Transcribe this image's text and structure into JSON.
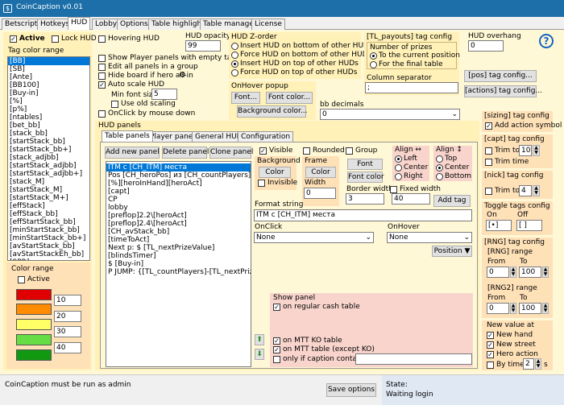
{
  "window": {
    "title": "CoinCaption v0.01"
  },
  "tabs": [
    "Betscript",
    "Hotkeys",
    "HUD",
    "Lobby",
    "Options",
    "Table highlight",
    "Table manager",
    "License"
  ],
  "hud": {
    "active": "Active",
    "lock_hud": "Lock HUD",
    "hovering_hud": "Hovering HUD",
    "tag_color_range": "Tag color range",
    "tags": [
      "[BB]",
      "[SB]",
      "[Ante]",
      "[BB100]",
      "[Buy-in]",
      "[%]",
      "[p%]",
      "[ntables]",
      "[bet_bb]",
      "[stack_bb]",
      "[startStack_bb]",
      "[startStack_bb+]",
      "[stack_adjbb]",
      "[startStack_adjbb]",
      "[startStack_adjbb+]",
      "[stack_M]",
      "[startStack_M]",
      "[startStack_M+]",
      "[effStack]",
      "[effStack_bb]",
      "[effStartStack_bb]",
      "[minStartStack_bb]",
      "[minStartStack_bb+]",
      "[avStartStack_bb]",
      "[avStartStackEh_bb]",
      "[SPR]"
    ],
    "color_range": {
      "label": "Color range",
      "active": "Active",
      "colors": [
        "#e00000",
        "#ff8c00",
        "#ffff66",
        "#66dd44",
        "#119911"
      ],
      "values": [
        "10",
        "20",
        "30",
        "40"
      ]
    },
    "options": {
      "show_player_panels": "Show Player panels with empty tags",
      "edit_all_panels": "Edit all panels in a group",
      "hide_board": "Hide board if hero all-in",
      "auto_scale": "Auto scale HUD",
      "min_font_size": "Min font size",
      "min_font_value": "5",
      "use_old_scaling": "Use old scaling",
      "onclick_mouse_down": "OnClick by mouse down"
    },
    "opacity": {
      "label": "HUD opacity",
      "value": "99"
    },
    "zorder": {
      "label": "HUD Z-order",
      "items": [
        "Insert HUD on bottom of other HUDs",
        "Force HUD on bottom of other HUDs",
        "Insert HUD on top of other HUDs",
        "Force HUD on top of other HUDs"
      ],
      "selected": 2
    },
    "onhover_popup": {
      "label": "OnHover popup",
      "font": "Font...",
      "font_color": "Font color...",
      "bg_color": "Background color..."
    },
    "bb_decimals": {
      "label": "bb decimals",
      "value": "0"
    },
    "tl_payouts": {
      "label": "[TL_payouts] tag config",
      "prizes_label": "Number of prizes",
      "to_current": "To the current position",
      "for_final": "For the final table",
      "col_sep": "Column separator",
      "col_sep_value": ";"
    },
    "overhang": {
      "label": "HUD overhang",
      "value": "0"
    },
    "pos_config": "[pos] tag config...",
    "actions_config": "[actions] tag config...",
    "panels": {
      "label": "HUD panels",
      "subtabs": [
        "Table panels",
        "Player panels",
        "General HUD",
        "Configuration"
      ],
      "add": "Add new panel",
      "delete": "Delete panel",
      "clone": "Clone panel",
      "items": [
        "ITM с [CH_ITM] места",
        "Pos [CH_heroPos] из [CH_countPlayers]",
        "[%][heroInHand][heroAct]",
        "[capt]",
        "CP",
        "lobby",
        "[preflop]2.2\\[heroAct]",
        "[preflop]2.4\\[heroAct]",
        "[CH_avStack_bb]",
        "[timeToAct]",
        "Next p: $ [TL_nextPrizeValue]",
        "[blindsTimer]",
        "$ [Buy-in]",
        "P JUMP: {[TL_countPlayers]-[TL_nextPrize]}"
      ],
      "visible": "Visible",
      "rounded": "Rounded",
      "group": "Group",
      "background": "Background",
      "color": "Color",
      "invisible": "Invisible",
      "frame": "Frame",
      "frame_color": "Color",
      "width": "Width",
      "width_value": "0",
      "font": "Font",
      "font_color": "Font color",
      "border_width": "Border width",
      "border_value": "3",
      "fixed_width": "Fixed width",
      "fixed_value": "40",
      "align_h": "Align ↔",
      "left": "Left",
      "center": "Center",
      "right": "Right",
      "align_v": "Align ↕",
      "top": "Top",
      "vcenter": "Center",
      "bottom": "Bottom",
      "add_tag": "Add tag",
      "format_string": "Format string",
      "format_value": "ITM с [CH_ITM] места",
      "onclick": "OnClick",
      "onclick_value": "None",
      "onhover": "OnHover",
      "onhover_value": "None",
      "position": "Position ▼",
      "show_panel": "Show panel",
      "on_regular": "on regular cash table",
      "on_mtt_ko": "on MTT KO table",
      "on_mtt_ex": "on MTT table (except KO)",
      "only_caption": "only if caption contains"
    },
    "sizing": {
      "label": "[sizing] tag config",
      "add_action": "Add action symbol"
    },
    "capt": {
      "label": "[capt] tag config",
      "trim_to": "Trim to",
      "trim_value": "10",
      "trim_time": "Trim time"
    },
    "nick": {
      "label": "[nick] tag config",
      "trim_to": "Trim to",
      "trim_value": "4"
    },
    "toggle": {
      "label": "Toggle tags config",
      "on": "On",
      "off": "Off",
      "on_value": "[•]",
      "off_value": "[ ]"
    },
    "rng": {
      "label": "[RNG] tag config",
      "rng": "[RNG] range",
      "rng2": "[RNG2] range",
      "from": "From",
      "to": "To",
      "from1": "0",
      "to1": "100",
      "from2": "0",
      "to2": "100"
    },
    "new_value": {
      "label": "New value at",
      "new_hand": "New hand",
      "new_street": "New street",
      "hero_action": "Hero action",
      "by_timer": "By timer",
      "timer_value": "2",
      "s": "s"
    }
  },
  "status": {
    "admin": "CoinCaption must be run as admin",
    "save": "Save options",
    "state_label": "State:",
    "state_value": "Waiting login"
  }
}
